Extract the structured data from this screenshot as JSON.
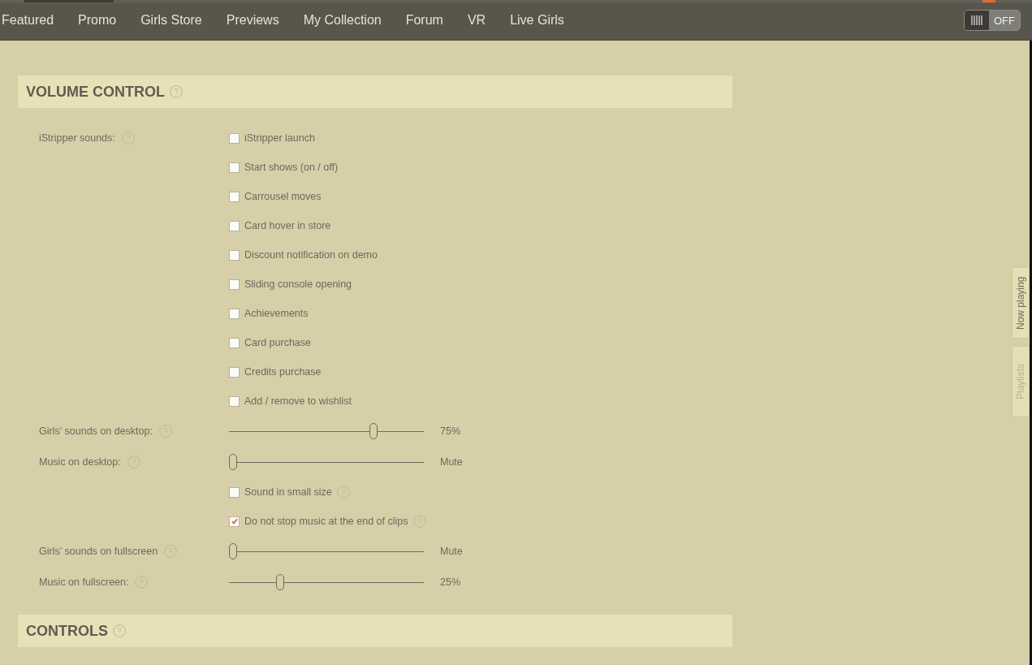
{
  "nav": {
    "items": [
      {
        "label": "Featured",
        "selected": false
      },
      {
        "label": "Promo",
        "selected": false
      },
      {
        "label": "Girls Store",
        "selected": false
      },
      {
        "label": "Previews",
        "selected": false
      },
      {
        "label": "My Collection",
        "selected": false
      },
      {
        "label": "Forum",
        "selected": false
      },
      {
        "label": "VR",
        "selected": false
      },
      {
        "label": "Live Girls",
        "selected": false
      }
    ],
    "toggle": {
      "on": false,
      "label": "OFF"
    }
  },
  "sections": [
    {
      "title": "VOLUME CONTROL",
      "help": true,
      "rows": [
        {
          "kind": "checkbox",
          "label": "iStripper sounds:",
          "label_help": true,
          "text": "iStripper launch",
          "checked": false
        },
        {
          "kind": "checkbox",
          "text": "Start shows (on / off)",
          "checked": false
        },
        {
          "kind": "checkbox",
          "text": "Carrousel moves",
          "checked": false
        },
        {
          "kind": "checkbox",
          "text": "Card hover in store",
          "checked": false
        },
        {
          "kind": "checkbox",
          "text": "Discount notification on demo",
          "checked": false
        },
        {
          "kind": "checkbox",
          "text": "Sliding console opening",
          "checked": false
        },
        {
          "kind": "checkbox",
          "text": "Achievements",
          "checked": false
        },
        {
          "kind": "checkbox",
          "text": "Card purchase",
          "checked": false
        },
        {
          "kind": "checkbox",
          "text": "Credits purchase",
          "checked": false
        },
        {
          "kind": "checkbox",
          "text": "Add / remove to wishlist",
          "checked": false
        },
        {
          "kind": "slider",
          "label": "Girls' sounds on desktop:",
          "label_help": true,
          "level": 0.75,
          "reading": "75%"
        },
        {
          "kind": "slider",
          "label": "Music on desktop:",
          "label_help": true,
          "level": 0,
          "reading": "Mute"
        },
        {
          "kind": "checkbox",
          "text": "Sound in small size",
          "checked": false,
          "help": true
        },
        {
          "kind": "checkbox",
          "text": "Do not stop music at the end of clips",
          "checked": true,
          "help": true
        },
        {
          "kind": "slider",
          "label": "Girls' sounds on fullscreen",
          "label_help": true,
          "level": 0,
          "reading": "Mute"
        },
        {
          "kind": "slider",
          "label": "Music on fullscreen:",
          "label_help": true,
          "level": 0.25,
          "reading": "25%"
        }
      ]
    },
    {
      "title": "CONTROLS",
      "help": true
    }
  ],
  "side_tabs": [
    {
      "label": "Now playing",
      "selected": true
    },
    {
      "label": "Playlists",
      "selected": false
    }
  ]
}
